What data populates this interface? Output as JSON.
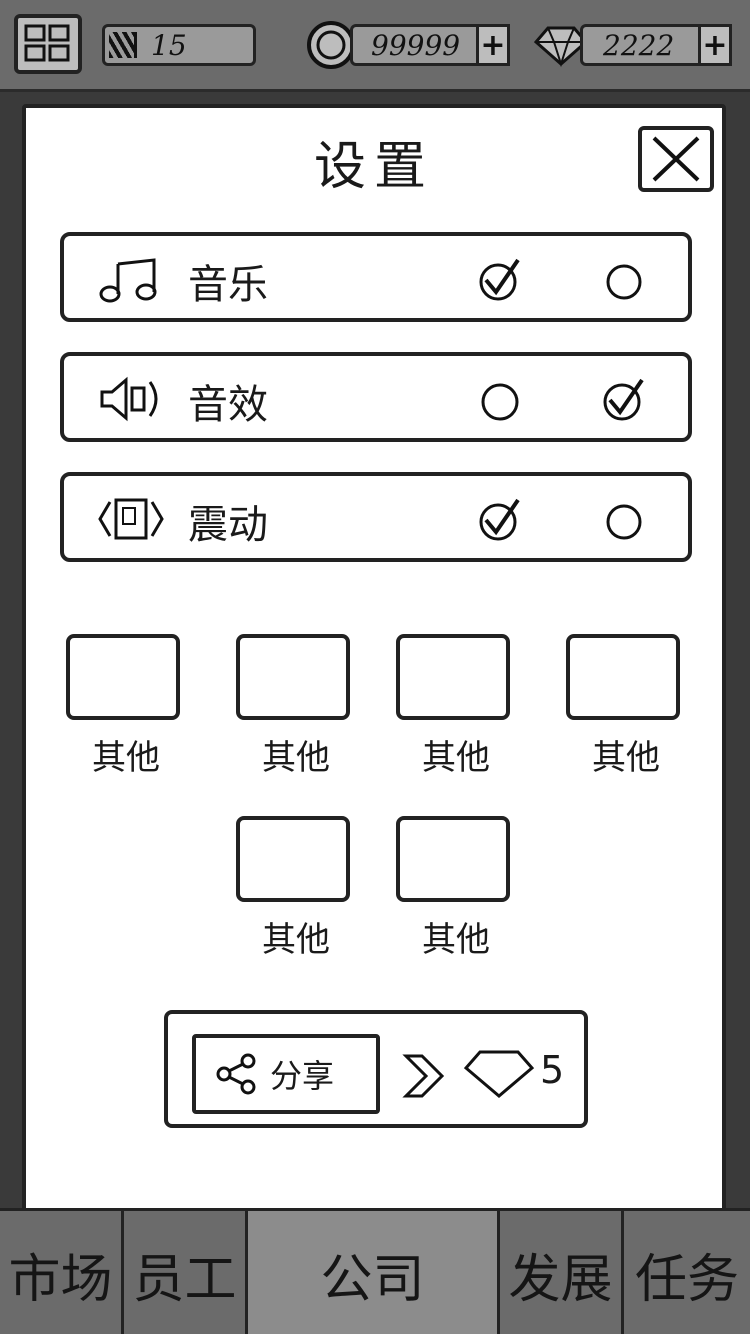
{
  "topbar": {
    "level": "15",
    "coins": "99999",
    "gems": "2222",
    "plus_label": "+"
  },
  "dialog": {
    "title": "设置",
    "settings": [
      {
        "label": "音乐",
        "icon": "music-icon",
        "enabled": true
      },
      {
        "label": "音效",
        "icon": "speaker-icon",
        "enabled": false
      },
      {
        "label": "震动",
        "icon": "vibrate-icon",
        "enabled": true
      }
    ],
    "others": [
      "其他",
      "其他",
      "其他",
      "其他",
      "其他",
      "其他"
    ],
    "share": {
      "label": "分享",
      "reward": "5"
    }
  },
  "bottom_nav": {
    "tabs": [
      {
        "label": "市场",
        "active": false
      },
      {
        "label": "员工",
        "active": false
      },
      {
        "label": "公司",
        "active": true
      },
      {
        "label": "发展",
        "active": false
      },
      {
        "label": "任务",
        "active": false
      }
    ]
  }
}
